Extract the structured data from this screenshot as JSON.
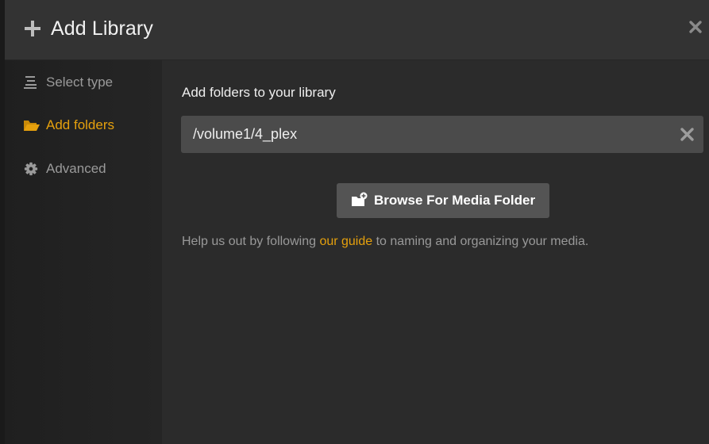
{
  "header": {
    "title": "Add Library"
  },
  "sidebar": {
    "items": [
      {
        "label": "Select type",
        "icon": "list-icon",
        "active": false
      },
      {
        "label": "Add folders",
        "icon": "folder-open-icon",
        "active": true
      },
      {
        "label": "Advanced",
        "icon": "gear-icon",
        "active": false
      }
    ]
  },
  "main": {
    "section_title": "Add folders to your library",
    "folder_path": "/volume1/4_plex",
    "browse_button_label": "Browse For Media Folder",
    "help": {
      "before": "Help us out by following ",
      "link": "our guide",
      "after": " to naming and organizing your media."
    }
  },
  "colors": {
    "accent": "#e5a00d",
    "header_bg": "#333333",
    "content_bg": "#2b2b2b",
    "input_bg": "#4b4b4b",
    "button_bg": "#545454"
  }
}
